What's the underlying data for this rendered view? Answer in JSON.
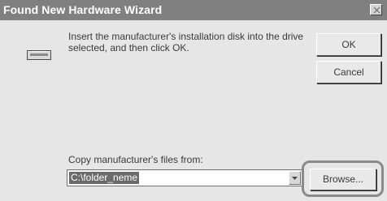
{
  "window": {
    "title": "Found New Hardware Wizard",
    "close_glyph": "×"
  },
  "message": "Insert the manufacturer's installation disk into the drive selected, and then click OK.",
  "buttons": {
    "ok_label": "OK",
    "cancel_label": "Cancel",
    "browse_label": "Browse..."
  },
  "copy_from": {
    "label": "Copy manufacturer's files from:",
    "value": "C:\\folder_neme"
  },
  "icons": {
    "disk": "disk-drive-icon",
    "dropdown": "chevron-down-icon",
    "close": "close-icon"
  },
  "colors": {
    "titlebar": "#808080",
    "dialog_background": "#e6e6e6",
    "selection": "#6a6a6a",
    "highlight_ring": "#8a8a8a"
  }
}
